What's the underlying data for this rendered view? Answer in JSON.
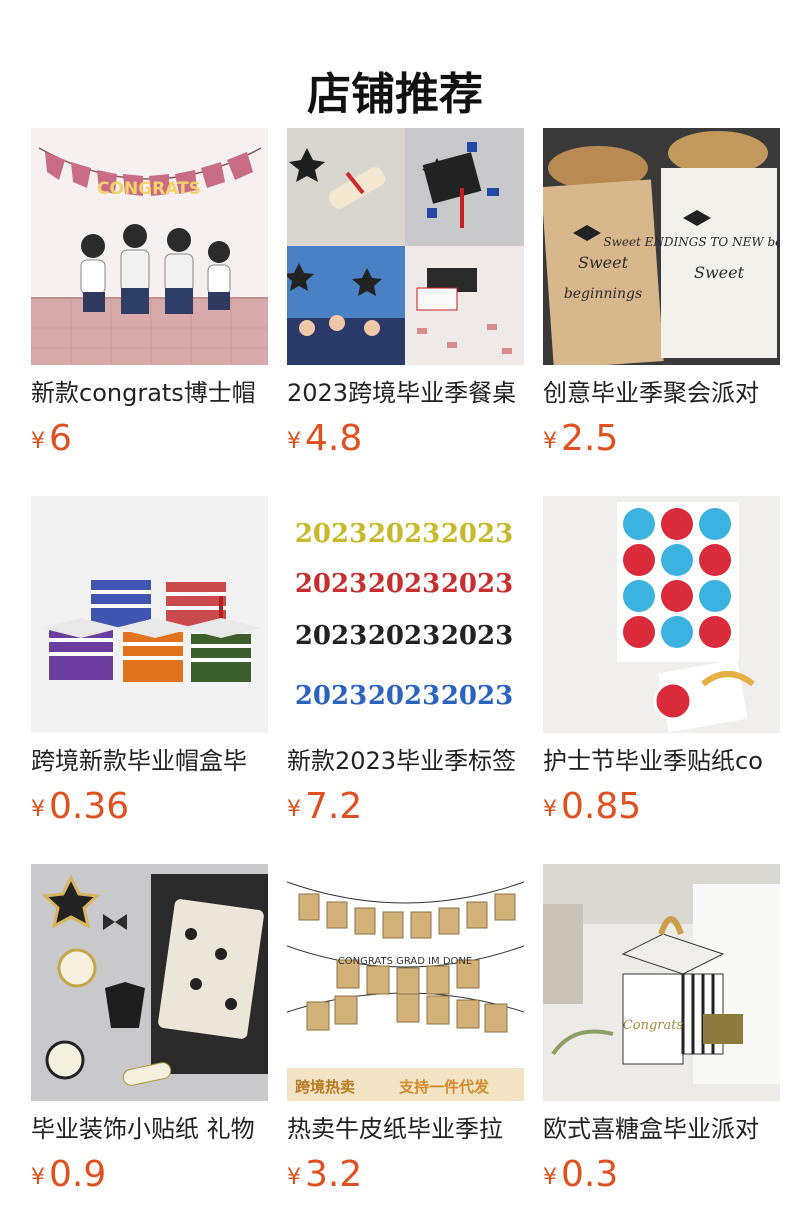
{
  "page": {
    "title": "店铺推荐"
  },
  "products": [
    {
      "name": "新款congrats博士帽",
      "currency": "¥",
      "price": "6",
      "image_label": "CONGRATS"
    },
    {
      "name": "2023跨境毕业季餐桌",
      "currency": "¥",
      "price": "4.8"
    },
    {
      "name": "创意毕业季聚会派对",
      "currency": "¥",
      "price": "2.5",
      "image_label": "Sweet ENDINGS TO NEW beginnings"
    },
    {
      "name": "跨境新款毕业帽盒毕",
      "currency": "¥",
      "price": "0.36"
    },
    {
      "name": "新款2023毕业季标签",
      "currency": "¥",
      "price": "7.2",
      "image_label": "2023"
    },
    {
      "name": "护士节毕业季贴纸co",
      "currency": "¥",
      "price": "0.85"
    },
    {
      "name": "毕业装饰小贴纸 礼物",
      "currency": "¥",
      "price": "0.9"
    },
    {
      "name": "热卖牛皮纸毕业季拉",
      "currency": "¥",
      "price": "3.2",
      "image_label": "CONGRATS GRAD IM DONE",
      "banner_left": "跨境热卖",
      "banner_right": "支持一件代发"
    },
    {
      "name": "欧式喜糖盒毕业派对",
      "currency": "¥",
      "price": "0.3",
      "image_label": "Congrats"
    }
  ],
  "colors": {
    "price": "#e0501f",
    "title": "#111111",
    "name": "#222222"
  }
}
